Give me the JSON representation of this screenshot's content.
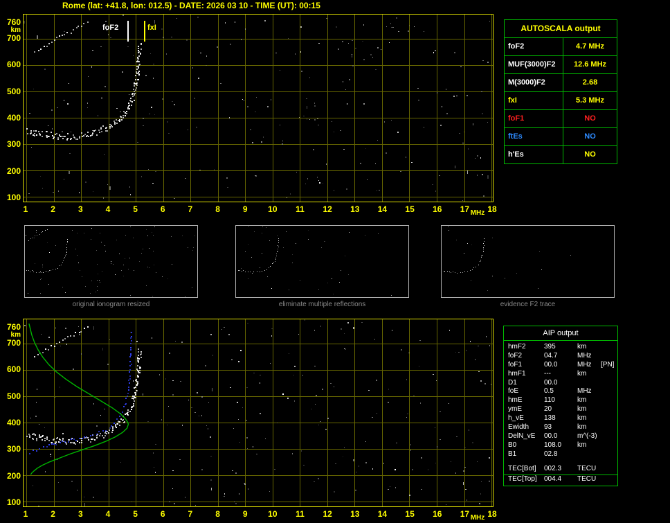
{
  "title": "Rome (lat: +41.8, lon: 012.5) - DATE: 2026 03 10 - TIME (UT): 00:15",
  "colors": {
    "accent_yellow": "#ffff00",
    "frame": "#e0e000",
    "grid": "#666600",
    "table_border": "#00bb00",
    "trace_white": "#ffffff",
    "profile_green": "#00b400",
    "model_blue": "#3344ff",
    "alert_red": "#ff2020",
    "info_blue": "#2e8bff",
    "caption_gray": "#8a8a8a"
  },
  "autoscala": {
    "header": "AUTOSCALA output",
    "rows": [
      {
        "label": "foF2",
        "value": "4.7 MHz",
        "label_color": "#ffffff",
        "value_color": "#ffff00"
      },
      {
        "label": "MUF(3000)F2",
        "value": "12.6 MHz",
        "label_color": "#ffffff",
        "value_color": "#ffff00"
      },
      {
        "label": "M(3000)F2",
        "value": "2.68",
        "label_color": "#ffffff",
        "value_color": "#ffff00"
      },
      {
        "label": "fxI",
        "value": "5.3 MHz",
        "label_color": "#ffff00",
        "value_color": "#ffff00"
      },
      {
        "label": "foF1",
        "value": "NO",
        "label_color": "#ff2020",
        "value_color": "#ff2020"
      },
      {
        "label": "ftEs",
        "value": "NO",
        "label_color": "#2e8bff",
        "value_color": "#2e8bff"
      },
      {
        "label": "h'Es",
        "value": "NO",
        "label_color": "#ffffff",
        "value_color": "#ffff00"
      }
    ]
  },
  "thumbnails": [
    {
      "caption": "original ionogram resized"
    },
    {
      "caption": "eliminate multiple reflections"
    },
    {
      "caption": "evidence F2 trace"
    }
  ],
  "aip": {
    "header": "AIP output",
    "rows": [
      {
        "label": "hmF2",
        "value": "395",
        "unit": "km",
        "extra": ""
      },
      {
        "label": "foF2",
        "value": "04.7",
        "unit": "MHz",
        "extra": ""
      },
      {
        "label": "foF1",
        "value": "00.0",
        "unit": "MHz",
        "extra": "[PN]"
      },
      {
        "label": "hmF1",
        "value": "---",
        "unit": "km",
        "extra": ""
      },
      {
        "label": "D1",
        "value": "00.0",
        "unit": "",
        "extra": ""
      },
      {
        "label": "foE",
        "value": "0.5",
        "unit": "MHz",
        "extra": ""
      },
      {
        "label": "hmE",
        "value": "110",
        "unit": "km",
        "extra": ""
      },
      {
        "label": "ymE",
        "value": "20",
        "unit": "km",
        "extra": ""
      },
      {
        "label": "h_vE",
        "value": "138",
        "unit": "km",
        "extra": ""
      },
      {
        "label": "Ewidth",
        "value": "93",
        "unit": "km",
        "extra": ""
      },
      {
        "label": "DelN_vE",
        "value": "00.0",
        "unit": "m^(-3)",
        "extra": ""
      },
      {
        "label": "B0",
        "value": "108.0",
        "unit": "km",
        "extra": ""
      },
      {
        "label": "B1",
        "value": "02.8",
        "unit": "",
        "extra": ""
      }
    ],
    "tec_rows": [
      {
        "label": "TEC[Bot]",
        "value": "002.3",
        "unit": "TECU"
      },
      {
        "label": "TEC[Top]",
        "value": "004.4",
        "unit": "TECU"
      }
    ]
  },
  "chart_data": {
    "type": "scatter",
    "description": "Ionogram with AUTOSCALA autoscaled trace (top), processing thumbnails (middle) and ionogram with AIP electron-density profile (bottom)",
    "x_axis": {
      "label": "MHz",
      "ticks": [
        1,
        2,
        3,
        4,
        5,
        6,
        7,
        8,
        9,
        10,
        11,
        12,
        13,
        14,
        15,
        16,
        17,
        18
      ],
      "range": [
        1,
        18.1
      ]
    },
    "y_axis": {
      "label": "km",
      "ticks": [
        760,
        700,
        600,
        500,
        400,
        300,
        200,
        100
      ],
      "range": [
        80,
        790
      ]
    },
    "annotations": {
      "foF2_marker": {
        "label": "foF2",
        "freq_mhz": 4.7
      },
      "fxI_marker": {
        "label": "fxI",
        "freq_mhz": 5.3
      }
    },
    "series": {
      "f2_trace": {
        "name": "F2-layer echo trace (virtual height vs frequency)",
        "color": "#ffffff",
        "style": "dots-dense",
        "points_mhz_km": [
          [
            1.05,
            352
          ],
          [
            1.2,
            348
          ],
          [
            1.4,
            344
          ],
          [
            1.6,
            340
          ],
          [
            1.8,
            336
          ],
          [
            2.0,
            333
          ],
          [
            2.2,
            331
          ],
          [
            2.45,
            330
          ],
          [
            2.7,
            331
          ],
          [
            2.95,
            334
          ],
          [
            3.2,
            338
          ],
          [
            3.45,
            344
          ],
          [
            3.7,
            352
          ],
          [
            3.9,
            362
          ],
          [
            4.1,
            374
          ],
          [
            4.3,
            390
          ],
          [
            4.5,
            410
          ],
          [
            4.65,
            432
          ],
          [
            4.8,
            460
          ],
          [
            4.9,
            492
          ],
          [
            4.98,
            528
          ],
          [
            5.04,
            565
          ],
          [
            5.08,
            605
          ],
          [
            5.11,
            645
          ],
          [
            5.13,
            685
          ]
        ]
      },
      "second_order": {
        "name": "second-order reflection trace",
        "color": "#ffffff",
        "style": "dots",
        "points_mhz_km": [
          [
            1.3,
            650
          ],
          [
            1.5,
            663
          ],
          [
            1.7,
            676
          ],
          [
            1.9,
            689
          ],
          [
            2.1,
            701
          ],
          [
            2.3,
            713
          ],
          [
            2.5,
            724
          ],
          [
            2.7,
            735
          ],
          [
            2.9,
            746
          ],
          [
            3.1,
            757
          ],
          [
            3.3,
            768
          ]
        ]
      },
      "electron_density_profile": {
        "name": "AIP electron density profile (plasma frequency vs real height)",
        "color": "#00b400",
        "style": "line",
        "points_mhz_km": [
          [
            1.1,
            775
          ],
          [
            1.2,
            732
          ],
          [
            1.3,
            704
          ],
          [
            1.43,
            676
          ],
          [
            1.6,
            648
          ],
          [
            1.82,
            620
          ],
          [
            2.1,
            592
          ],
          [
            2.45,
            564
          ],
          [
            2.85,
            536
          ],
          [
            3.3,
            508
          ],
          [
            3.75,
            480
          ],
          [
            4.15,
            455
          ],
          [
            4.45,
            432
          ],
          [
            4.62,
            414
          ],
          [
            4.71,
            400
          ],
          [
            4.73,
            393
          ],
          [
            4.68,
            378
          ],
          [
            4.52,
            362
          ],
          [
            4.25,
            345
          ],
          [
            3.9,
            328
          ],
          [
            3.5,
            312
          ],
          [
            3.05,
            296
          ],
          [
            2.6,
            280
          ],
          [
            2.2,
            264
          ],
          [
            1.85,
            250
          ],
          [
            1.58,
            237
          ],
          [
            1.4,
            226
          ],
          [
            1.28,
            216
          ],
          [
            1.2,
            208
          ],
          [
            1.16,
            202
          ]
        ]
      },
      "model_trace": {
        "name": "restored model trace",
        "color": "#3344ff",
        "style": "dots",
        "points_mhz_km": [
          [
            1.1,
            285
          ],
          [
            1.35,
            298
          ],
          [
            1.6,
            308
          ],
          [
            1.9,
            318
          ],
          [
            2.2,
            326
          ],
          [
            2.5,
            332
          ],
          [
            2.8,
            338
          ],
          [
            3.1,
            345
          ],
          [
            3.4,
            354
          ],
          [
            3.65,
            364
          ],
          [
            3.9,
            377
          ],
          [
            4.1,
            392
          ],
          [
            4.3,
            412
          ],
          [
            4.45,
            436
          ],
          [
            4.58,
            466
          ],
          [
            4.67,
            500
          ],
          [
            4.73,
            540
          ],
          [
            4.77,
            582
          ],
          [
            4.79,
            625
          ],
          [
            4.81,
            668
          ],
          [
            4.82,
            712
          ],
          [
            4.83,
            755
          ]
        ]
      }
    },
    "plots": [
      {
        "name": "main-ionogram",
        "grid": true,
        "markers": true,
        "noise_seed": 42,
        "noise_dots": 250,
        "series": [
          "second_order",
          "f2_trace"
        ]
      },
      {
        "name": "profile-ionogram",
        "grid": true,
        "markers": false,
        "noise_seed": 77,
        "noise_dots": 250,
        "series": [
          "second_order",
          "f2_trace",
          "model_trace",
          "electron_density_profile"
        ]
      },
      {
        "name": "thumb-original",
        "grid": false,
        "markers": false,
        "noise_seed": 11,
        "noise_dots": 90,
        "series": [
          "second_order",
          "f2_trace"
        ]
      },
      {
        "name": "thumb-cleaned",
        "grid": false,
        "markers": false,
        "noise_seed": 12,
        "noise_dots": 40,
        "series": [
          "f2_trace"
        ]
      },
      {
        "name": "thumb-f2",
        "grid": false,
        "markers": false,
        "noise_seed": 13,
        "noise_dots": 16,
        "series": [
          "f2_trace"
        ]
      }
    ]
  }
}
